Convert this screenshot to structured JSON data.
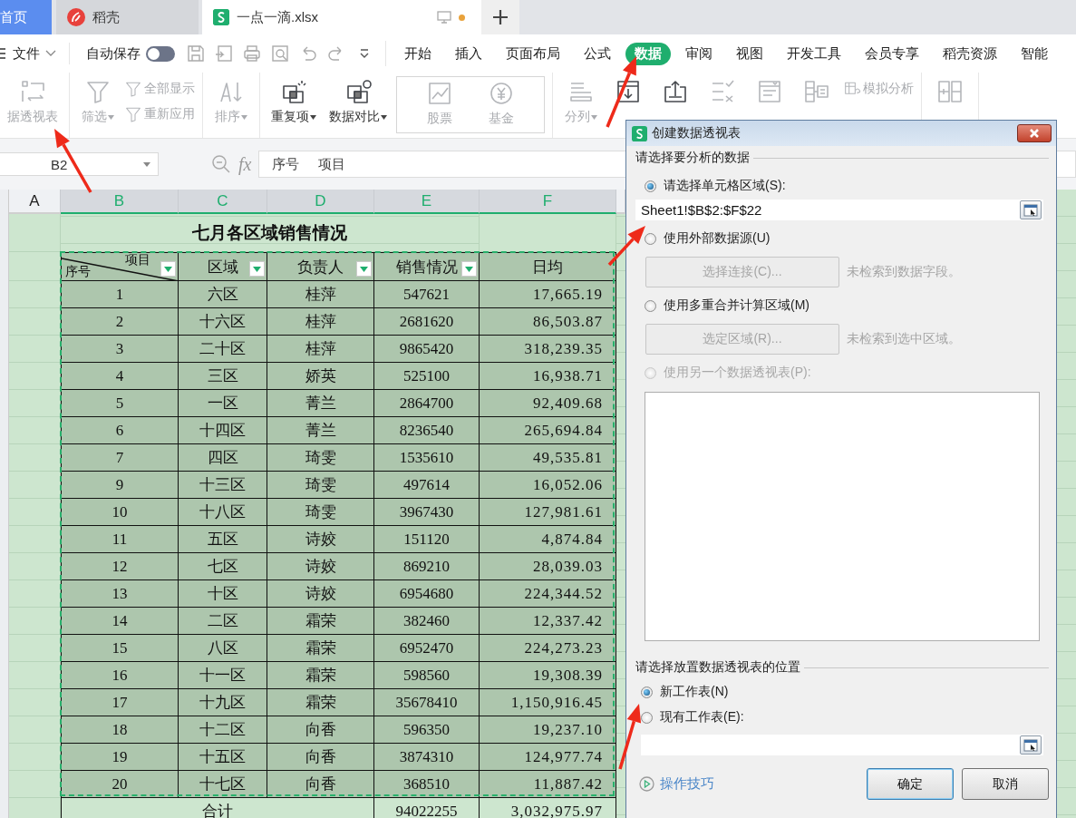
{
  "tabs": [
    {
      "kind": "home",
      "label": "首页",
      "selected": false
    },
    {
      "kind": "docer",
      "label": "稻壳",
      "selected": false
    },
    {
      "kind": "sheet",
      "label": "一点一滴.xlsx",
      "selected": true
    }
  ],
  "menu": {
    "file": "文件",
    "autosave": {
      "label": "自动保存",
      "on": false
    },
    "tabs": [
      {
        "label": "开始",
        "selected": false
      },
      {
        "label": "插入",
        "selected": false
      },
      {
        "label": "页面布局",
        "selected": false
      },
      {
        "label": "公式",
        "selected": false
      },
      {
        "label": "数据",
        "selected": true
      },
      {
        "label": "审阅",
        "selected": false
      },
      {
        "label": "视图",
        "selected": false
      },
      {
        "label": "开发工具",
        "selected": false
      },
      {
        "label": "会员专享",
        "selected": false
      },
      {
        "label": "稻壳资源",
        "selected": false
      },
      {
        "label": "智能",
        "selected": false
      }
    ]
  },
  "ribbon": [
    {
      "items": [
        {
          "kind": "pivot",
          "label": "据透视表",
          "menu": false,
          "disabled": true
        }
      ]
    },
    {
      "items": [
        {
          "kind": "filter",
          "label": "筛选",
          "menu": true,
          "disabled": true
        },
        {
          "kind": "stack",
          "items": [
            {
              "kind": "show-all",
              "label": "全部显示",
              "disabled": true
            },
            {
              "kind": "reapply",
              "label": "重新应用",
              "disabled": true
            }
          ]
        }
      ]
    },
    {
      "items": [
        {
          "kind": "sort",
          "label": "排序",
          "menu": true,
          "disabled": true
        }
      ]
    },
    {
      "items": [
        {
          "kind": "duplicate",
          "label": "重复项",
          "menu": true,
          "disabled": false
        },
        {
          "kind": "compare",
          "label": "数据对比",
          "menu": true,
          "disabled": false
        },
        {
          "kind": "gallery",
          "items": [
            {
              "kind": "stock",
              "label": "股票",
              "disabled": true
            },
            {
              "kind": "fund",
              "label": "基金",
              "disabled": true
            }
          ]
        }
      ]
    },
    {
      "items": [
        {
          "kind": "split",
          "label": "分列",
          "menu": true,
          "disabled": true
        },
        {
          "kind": "fill",
          "disabled": false
        },
        {
          "kind": "lookup",
          "disabled": false
        },
        {
          "kind": "validity",
          "disabled": true
        },
        {
          "kind": "dropdown",
          "disabled": true
        },
        {
          "kind": "consolidate",
          "disabled": true
        },
        {
          "kind": "stack",
          "items": [
            {
              "kind": "simulate",
              "label": "模拟分析",
              "disabled": true
            }
          ]
        }
      ]
    },
    {
      "items": [
        {
          "kind": "group",
          "disabled": true
        }
      ]
    }
  ],
  "sheet": {
    "name_box": "B2",
    "fx": "fx",
    "formula": "序号     项目",
    "row_label_column": {
      "label": "A",
      "selected": false
    },
    "columns": [
      {
        "label": "B",
        "selected": true
      },
      {
        "label": "C",
        "selected": true
      },
      {
        "label": "D",
        "selected": true
      },
      {
        "label": "E",
        "selected": true
      },
      {
        "label": "F",
        "selected": true
      }
    ],
    "title": "七月各区域销售情况",
    "headers": [
      {
        "kind": "diagonal",
        "left": "序号",
        "right": "项目",
        "filter": true
      },
      {
        "kind": "text",
        "text": "区域",
        "filter": true
      },
      {
        "kind": "text",
        "text": "负责人",
        "filter": true
      },
      {
        "kind": "text",
        "text": "销售情况",
        "filter": true
      },
      {
        "kind": "text",
        "text": "日均",
        "filter": false
      }
    ],
    "rows": [
      [
        "1",
        "六区",
        "桂萍",
        "547621",
        "17,665.19"
      ],
      [
        "2",
        "十六区",
        "桂萍",
        "2681620",
        "86,503.87"
      ],
      [
        "3",
        "二十区",
        "桂萍",
        "9865420",
        "318,239.35"
      ],
      [
        "4",
        "三区",
        "娇英",
        "525100",
        "16,938.71"
      ],
      [
        "5",
        "一区",
        "菁兰",
        "2864700",
        "92,409.68"
      ],
      [
        "6",
        "十四区",
        "菁兰",
        "8236540",
        "265,694.84"
      ],
      [
        "7",
        "四区",
        "琦雯",
        "1535610",
        "49,535.81"
      ],
      [
        "9",
        "十三区",
        "琦雯",
        "497614",
        "16,052.06"
      ],
      [
        "10",
        "十八区",
        "琦雯",
        "3967430",
        "127,981.61"
      ],
      [
        "11",
        "五区",
        "诗姣",
        "151120",
        "4,874.84"
      ],
      [
        "12",
        "七区",
        "诗姣",
        "869210",
        "28,039.03"
      ],
      [
        "13",
        "十区",
        "诗姣",
        "6954680",
        "224,344.52"
      ],
      [
        "14",
        "二区",
        "霜荣",
        "382460",
        "12,337.42"
      ],
      [
        "15",
        "八区",
        "霜荣",
        "6952470",
        "224,273.23"
      ],
      [
        "16",
        "十一区",
        "霜荣",
        "598560",
        "19,308.39"
      ],
      [
        "17",
        "十九区",
        "霜荣",
        "35678410",
        "1,150,916.45"
      ],
      [
        "18",
        "十二区",
        "向香",
        "596350",
        "19,237.10"
      ],
      [
        "19",
        "十五区",
        "向香",
        "3874310",
        "124,977.74"
      ],
      [
        "20",
        "十七区",
        "向香",
        "368510",
        "11,887.42"
      ]
    ],
    "total": {
      "label": "合计",
      "sales": "94022255",
      "daily": "3,032,975.97"
    }
  },
  "dialog": {
    "title": "创建数据透视表",
    "source_heading": "请选择要分析的数据",
    "sources": [
      {
        "kind": "range",
        "label": "请选择单元格区域(S):",
        "selected": true,
        "disabled": false,
        "value": "Sheet1!$B$2:$F$22"
      },
      {
        "kind": "button",
        "label": "使用外部数据源(U)",
        "selected": false,
        "disabled": false,
        "button": "选择连接(C)...",
        "note": "未检索到数据字段。"
      },
      {
        "kind": "button",
        "label": "使用多重合并计算区域(M)",
        "selected": false,
        "disabled": false,
        "button": "选定区域(R)...",
        "note": "未检索到选中区域。"
      },
      {
        "kind": "list",
        "label": "使用另一个数据透视表(P):",
        "selected": false,
        "disabled": true
      }
    ],
    "target_heading": "请选择放置数据透视表的位置",
    "targets": [
      {
        "kind": "plain",
        "label": "新工作表(N)",
        "selected": true
      },
      {
        "kind": "range",
        "label": "现有工作表(E):",
        "selected": false
      }
    ],
    "help": "操作技巧",
    "ok": "确定",
    "cancel": "取消"
  }
}
